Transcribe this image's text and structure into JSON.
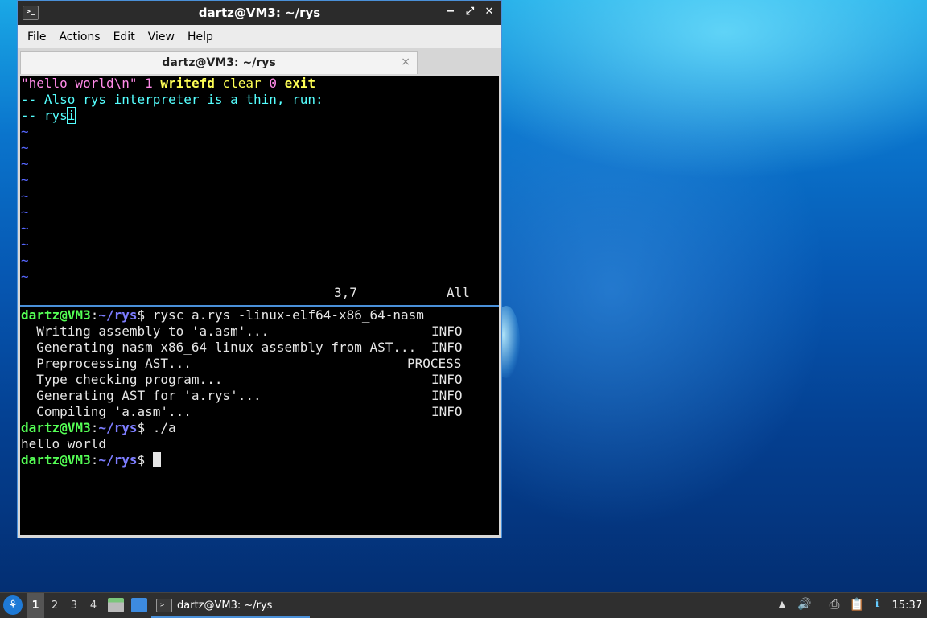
{
  "window": {
    "title": "dartz@VM3: ~/rys",
    "controls": {
      "minimize": "−",
      "maximize": "⤢",
      "close": "✕"
    },
    "menu": [
      "File",
      "Actions",
      "Edit",
      "View",
      "Help"
    ],
    "tab": {
      "label": "dartz@VM3: ~/rys",
      "close": "×"
    }
  },
  "editor": {
    "line1": {
      "str": "\"hello world\\n\"",
      "num1": "1",
      "kw1": "writefd",
      "word": "clear",
      "num2": "0",
      "kw2": "exit"
    },
    "line2": "-- Also rys interpreter is a thin, run:",
    "line3_prefix": "-- rys",
    "line3_cursor": "i",
    "tilde": "~",
    "tilde_count": 10,
    "status_pos": "3,7",
    "status_scroll": "All"
  },
  "shell": {
    "prompt_user": "dartz@VM3",
    "prompt_sep": ":",
    "prompt_path": "~/rys",
    "prompt_end": "$",
    "cmd1": " rysc a.rys -linux-elf64-x86_64-nasm",
    "log": [
      {
        "msg": "  Writing assembly to 'a.asm'...",
        "level": "INFO"
      },
      {
        "msg": "  Generating nasm x86_64 linux assembly from AST...",
        "level": "INFO"
      },
      {
        "msg": "  Preprocessing AST...",
        "level": "PROCESS"
      },
      {
        "msg": "  Type checking program...",
        "level": "INFO"
      },
      {
        "msg": "  Generating AST for 'a.rys'...",
        "level": "INFO"
      },
      {
        "msg": "  Compiling 'a.asm'...",
        "level": "INFO"
      }
    ],
    "cmd2": " ./a",
    "output": "hello world"
  },
  "taskbar": {
    "workspaces": [
      "1",
      "2",
      "3",
      "4"
    ],
    "active_workspace": "1",
    "task_label": "dartz@VM3: ~/rys",
    "clock": "15:37",
    "colors": {
      "accent": "#4a90d9",
      "taskbar_bg": "#2f2f2f"
    }
  }
}
